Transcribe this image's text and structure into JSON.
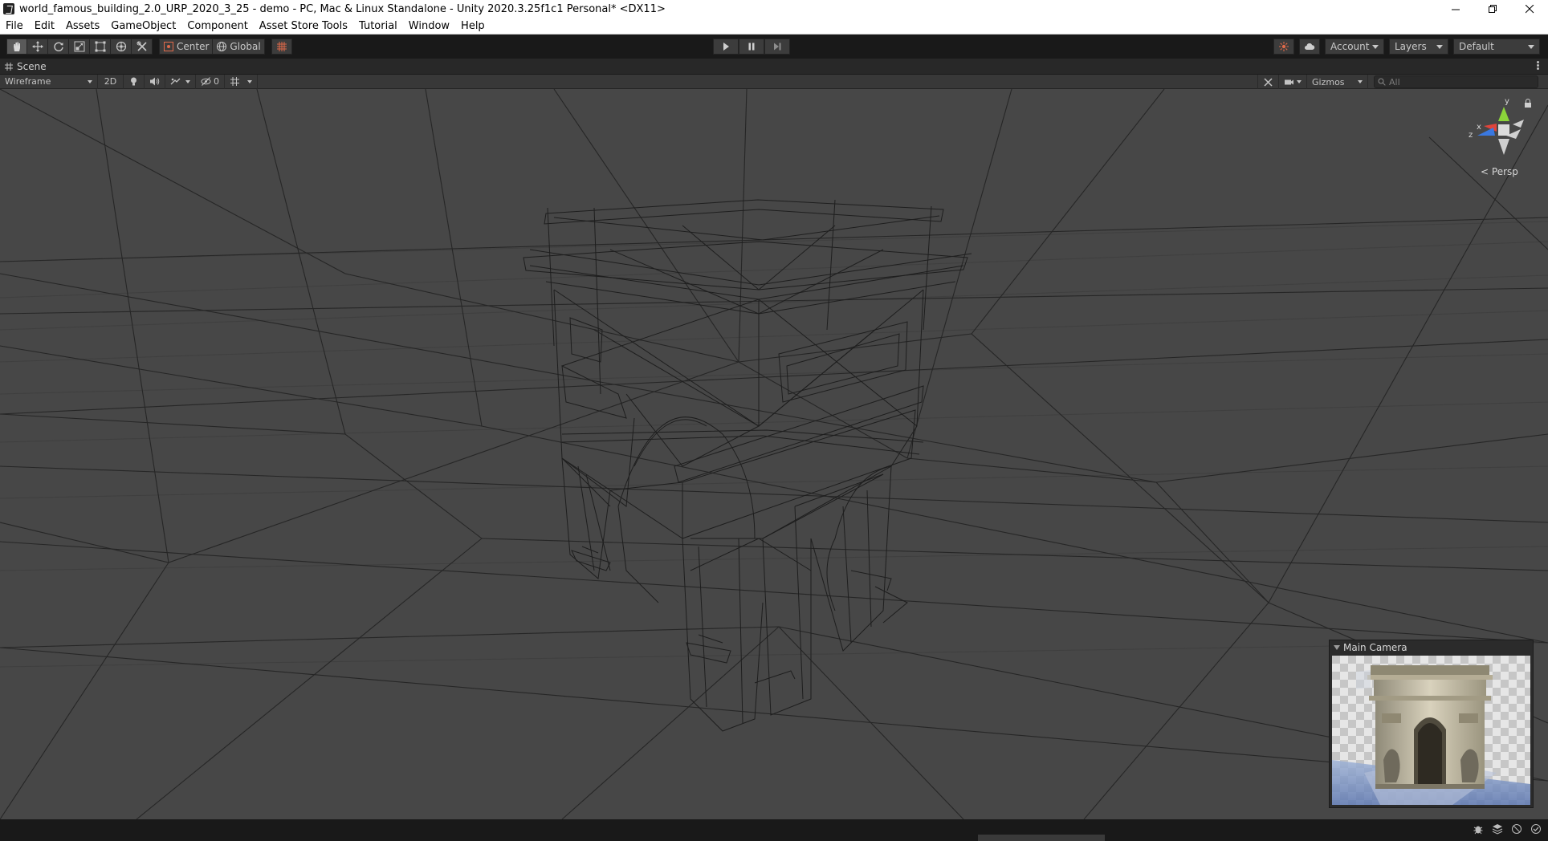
{
  "window": {
    "title": "world_famous_building_2.0_URP_2020_3_25 - demo - PC, Mac & Linux Standalone - Unity 2020.3.25f1c1 Personal* <DX11>"
  },
  "menu": {
    "items": [
      {
        "label": "File"
      },
      {
        "label": "Edit"
      },
      {
        "label": "Assets"
      },
      {
        "label": "GameObject"
      },
      {
        "label": "Component"
      },
      {
        "label": "Asset Store Tools"
      },
      {
        "label": "Tutorial"
      },
      {
        "label": "Window"
      },
      {
        "label": "Help"
      }
    ]
  },
  "toolbar": {
    "transform_tools": [
      {
        "icon": "hand-icon",
        "active": true
      },
      {
        "icon": "move-icon",
        "active": false
      },
      {
        "icon": "rotate-icon",
        "active": false
      },
      {
        "icon": "scale-icon",
        "active": false
      },
      {
        "icon": "rect-icon",
        "active": false
      },
      {
        "icon": "transform-icon",
        "active": false
      },
      {
        "icon": "custom-tool-icon",
        "active": false
      }
    ],
    "pivot_label": "Center",
    "space_label": "Global",
    "account_label": "Account",
    "layers_label": "Layers",
    "layout_label": "Default"
  },
  "scene": {
    "tab_label": "Scene",
    "draw_mode": "Wireframe",
    "mode_2d_label": "2D",
    "hidden_count": "0",
    "gizmos_label": "Gizmos",
    "search_placeholder": "All",
    "projection_label": "Persp",
    "axis_x": "x",
    "axis_y": "y",
    "axis_z": "z"
  },
  "camera_preview": {
    "title": "Main Camera"
  },
  "colors": {
    "viewport_bg": "#474747",
    "grid_line": "#2a2a2a",
    "axis_x": "#e0443a",
    "axis_y": "#8bd43a",
    "axis_z": "#3a78e0"
  }
}
